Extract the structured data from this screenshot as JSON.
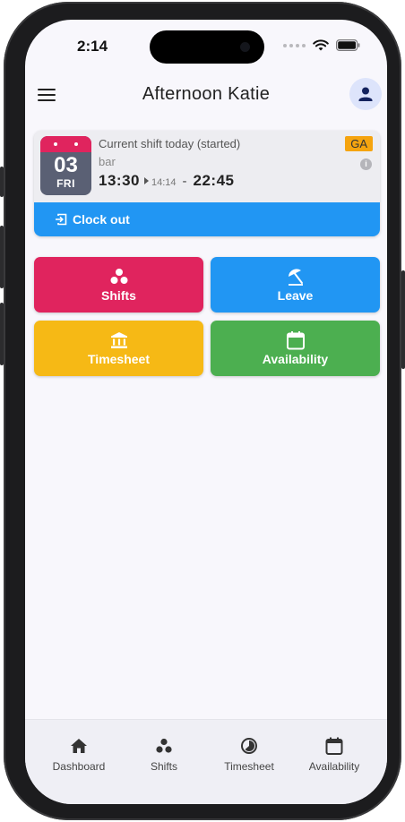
{
  "status_bar": {
    "time": "2:14"
  },
  "header": {
    "title": "Afternoon Katie"
  },
  "shift": {
    "day": "03",
    "weekday": "FRI",
    "title": "Current shift today (started)",
    "location": "bar",
    "start_time": "13:30",
    "actual_start": "14:14",
    "separator": "-",
    "end_time": "22:45",
    "badge": "GA",
    "clock_out_label": "Clock out"
  },
  "tiles": {
    "shifts": "Shifts",
    "leave": "Leave",
    "timesheet": "Timesheet",
    "availability": "Availability"
  },
  "bottom_nav": {
    "dashboard": "Dashboard",
    "shifts": "Shifts",
    "timesheet": "Timesheet",
    "availability": "Availability"
  },
  "colors": {
    "shifts_tile": "#e0245e",
    "leave_tile": "#2196f3",
    "timesheet_tile": "#f6b915",
    "availability_tile": "#4caf50",
    "clock_out_bar": "#2196f3",
    "badge": "#f5a40f"
  }
}
